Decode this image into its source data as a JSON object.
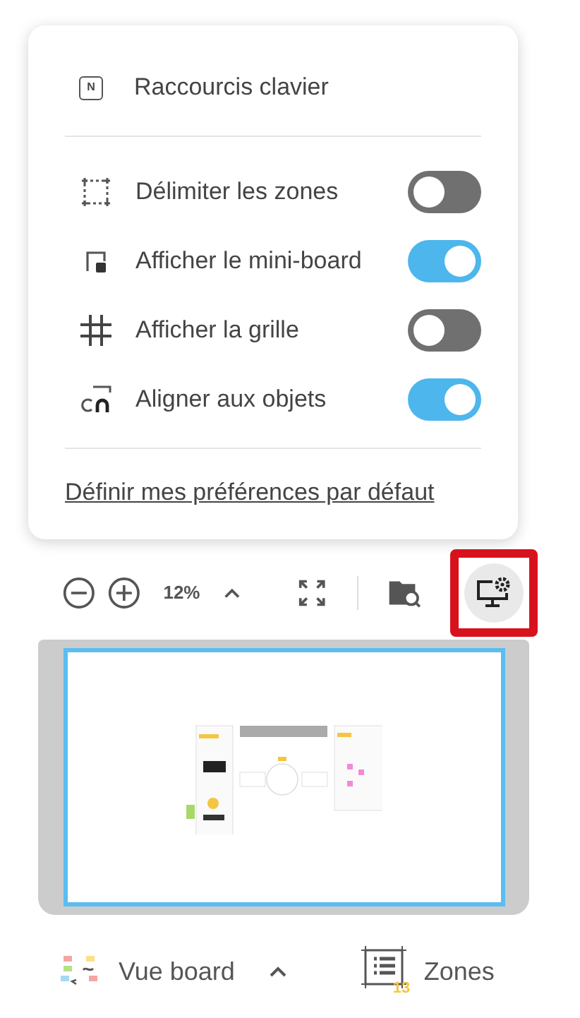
{
  "menu": {
    "shortcut": {
      "label": "Raccourcis clavier",
      "key": "N"
    },
    "toggles": [
      {
        "kind": "zones",
        "label": "Délimiter les zones",
        "on": false
      },
      {
        "kind": "minimap",
        "label": "Afficher le mini-board",
        "on": true
      },
      {
        "kind": "grid",
        "label": "Afficher la grille",
        "on": false
      },
      {
        "kind": "snap",
        "label": "Aligner aux objets",
        "on": true
      }
    ],
    "link": "Définir mes préférences par défaut"
  },
  "toolbar": {
    "zoom": "12%",
    "settings_highlighted": true
  },
  "bottom_bar": {
    "board_view": "Vue board",
    "zones": {
      "label": "Zones",
      "count": "13"
    }
  }
}
